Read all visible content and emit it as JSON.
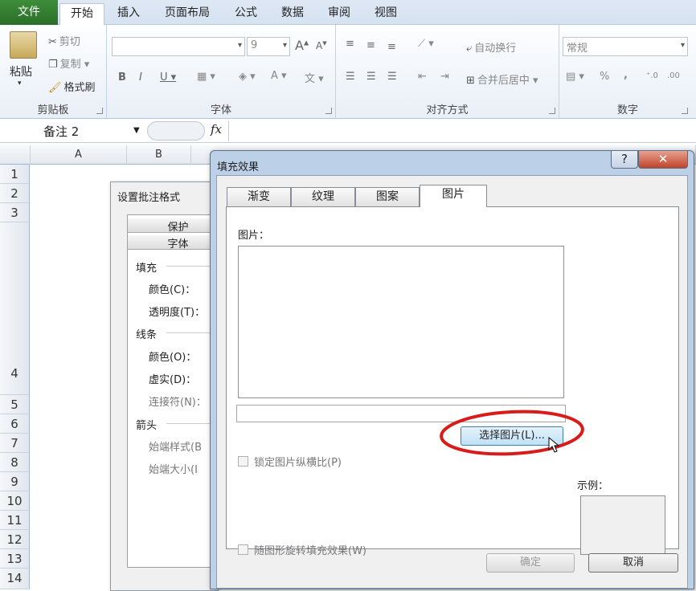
{
  "tabs": {
    "file": "文件",
    "home": "开始",
    "insert": "插入",
    "layout": "页面布局",
    "formula": "公式",
    "data": "数据",
    "review": "审阅",
    "view": "视图"
  },
  "ribbon": {
    "clipboard": {
      "label": "剪贴板",
      "paste": "粘贴",
      "cut": "剪切",
      "copy": "复制",
      "painter": "格式刷"
    },
    "font": {
      "label": "字体",
      "size": "9",
      "bold": "B",
      "italic": "I",
      "underline": "U",
      "font_color": "A",
      "grow": "A",
      "shrink": "A"
    },
    "align": {
      "label": "对齐方式",
      "wrap": "自动换行",
      "merge": "合并后居中"
    },
    "number": {
      "label": "数字",
      "format": "常规",
      "percent": "%",
      "comma": ","
    }
  },
  "name_box": "备注 2",
  "fx": "fx",
  "columns": [
    "A",
    "B"
  ],
  "rows": [
    "1",
    "2",
    "3",
    "4",
    "5",
    "6",
    "7",
    "8",
    "9",
    "10",
    "11",
    "12",
    "13",
    "14"
  ],
  "bg_dialog": {
    "title": "设置批注格式",
    "tab_protect": "保护",
    "tab_font": "字体",
    "fill": "填充",
    "color": "颜色(C)：",
    "transparency": "透明度(T)：",
    "line": "线条",
    "line_color": "颜色(O)：",
    "dash": "虚实(D)：",
    "connector": "连接符(N)：",
    "arrow": "箭头",
    "begin_style": "始端样式(B",
    "begin_size": "始端大小(I"
  },
  "fill_dialog": {
    "title": "填充效果",
    "help": "?",
    "close": "✕",
    "tabs": [
      "渐变",
      "纹理",
      "图案",
      "图片"
    ],
    "picture_label": "图片：",
    "select_button": "选择图片(L)...",
    "lock_ratio": "锁定图片纵横比(P)",
    "rotate": "随图形旋转填充效果(W)",
    "sample": "示例：",
    "ok": "确定",
    "cancel": "取消"
  },
  "colors": {
    "file_tab": "#2f7b2c",
    "annotation": "#d81c1c"
  }
}
